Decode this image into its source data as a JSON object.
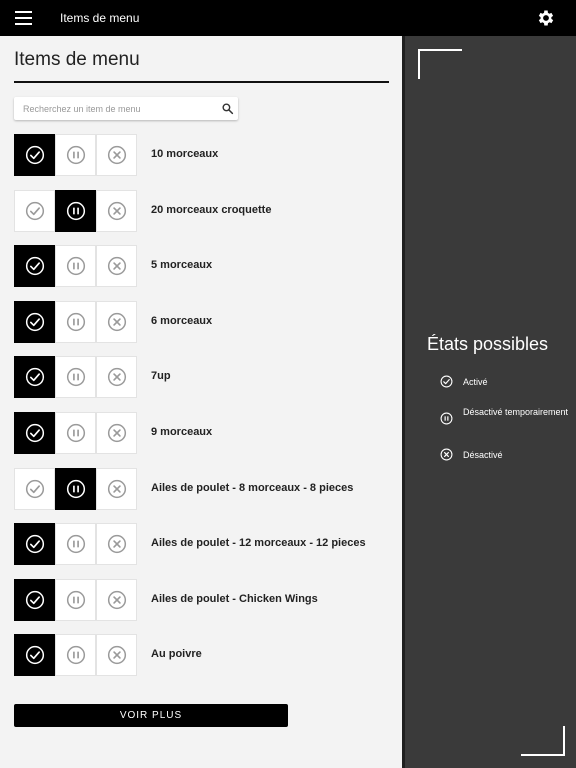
{
  "topbar": {
    "title": "Items de menu",
    "menu_icon": "hamburger-icon",
    "settings_icon": "gear-icon"
  },
  "main": {
    "title": "Items de menu",
    "search": {
      "placeholder": "Recherchez un item de menu",
      "value": "",
      "icon": "search-icon"
    },
    "items": [
      {
        "label": "10 morceaux",
        "state": "active"
      },
      {
        "label": "20 morceaux croquette",
        "state": "paused"
      },
      {
        "label": "5 morceaux",
        "state": "active"
      },
      {
        "label": "6 morceaux",
        "state": "active"
      },
      {
        "label": "7up",
        "state": "active"
      },
      {
        "label": "9 morceaux",
        "state": "active"
      },
      {
        "label": "Ailes de poulet - 8 morceaux - 8 pieces",
        "state": "paused"
      },
      {
        "label": "Ailes de poulet - 12 morceaux - 12 pieces",
        "state": "active"
      },
      {
        "label": "Ailes de poulet - Chicken Wings",
        "state": "active"
      },
      {
        "label": "Au poivre",
        "state": "active"
      }
    ],
    "more_button": "VOIR PLUS"
  },
  "side": {
    "title": "États possibles",
    "legend": [
      {
        "icon": "check-circle-icon",
        "label": "Activé"
      },
      {
        "icon": "pause-circle-icon",
        "label": "Désactivé temporairement"
      },
      {
        "icon": "x-circle-icon",
        "label": "Désactivé"
      }
    ]
  },
  "colors": {
    "topbar": "#000000",
    "active_button": "#000000",
    "side_panel": "#3a3a3a",
    "inactive_icon": "#9a9a9a"
  }
}
